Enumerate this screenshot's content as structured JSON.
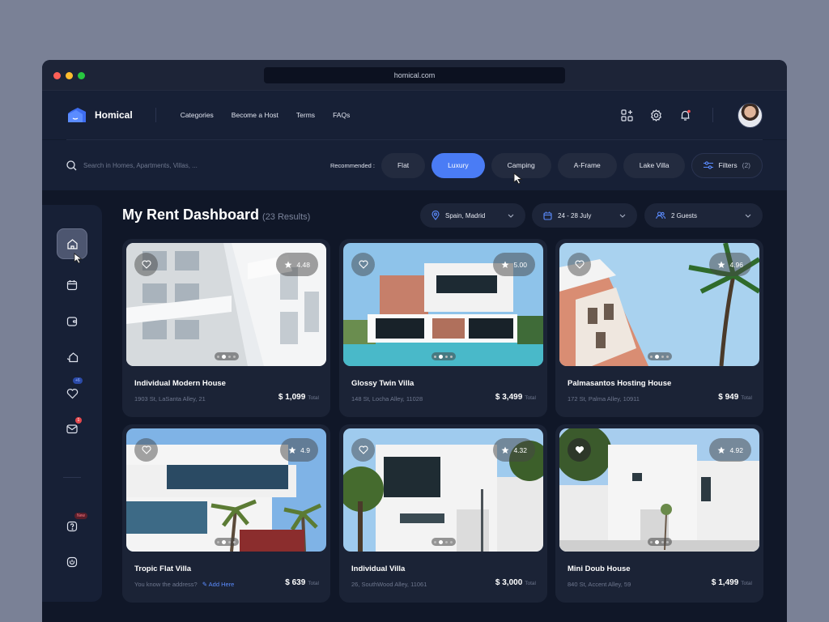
{
  "browser": {
    "url": "homical.com"
  },
  "brand": {
    "name": "Homical",
    "accent": "#4a7cf5"
  },
  "nav": {
    "links": [
      "Categories",
      "Become a Host",
      "Terms",
      "FAQs"
    ]
  },
  "search": {
    "placeholder": "Search in Homes, Apartments, Villas, ..."
  },
  "recommended": {
    "label": "Recommended :",
    "chips": [
      "Flat",
      "Luxury",
      "Camping",
      "A-Frame",
      "Lake Villa"
    ],
    "active": "Luxury",
    "filters_label": "Filters",
    "filters_count": "(2)"
  },
  "sidebar": {
    "items": [
      "home-icon",
      "calendar-icon",
      "wallet-icon",
      "house-icon",
      "heart-icon",
      "mail-icon",
      "help-icon",
      "power-icon"
    ],
    "favorites_badge": "+6",
    "mail_badge": "1",
    "help_badge": "New"
  },
  "dashboard": {
    "title": "My Rent Dashboard",
    "results": "(23 Results)",
    "location": "Spain, Madrid",
    "dates": "24 - 28 July",
    "guests": "2 Guests"
  },
  "listings": [
    {
      "name": "Individual Modern House",
      "address": "1903 St, LaSanta Alley, 21",
      "price": "$ 1,099",
      "price_suffix": "Total",
      "rating": "4.48"
    },
    {
      "name": "Glossy Twin Villa",
      "address": "148 St, Locha Alley, 11028",
      "price": "$ 3,499",
      "price_suffix": "Total",
      "rating": "5.00"
    },
    {
      "name": "Palmasantos Hosting House",
      "address": "172 St, Palma Alley, 10911",
      "price": "$ 949",
      "price_suffix": "Total",
      "rating": "4.96"
    },
    {
      "name": "Tropic Flat Villa",
      "address": "You know the address?",
      "add_link": "Add Here",
      "price": "$ 639",
      "price_suffix": "Total",
      "rating": "4.9"
    },
    {
      "name": "Individual Villa",
      "address": "26, SouthWood Alley, 11061",
      "price": "$ 3,000",
      "price_suffix": "Total",
      "rating": "4.32"
    },
    {
      "name": "Mini Doub House",
      "address": "840 St, Accent Alley, 59",
      "price": "$ 1,499",
      "price_suffix": "Total",
      "rating": "4.92"
    }
  ]
}
